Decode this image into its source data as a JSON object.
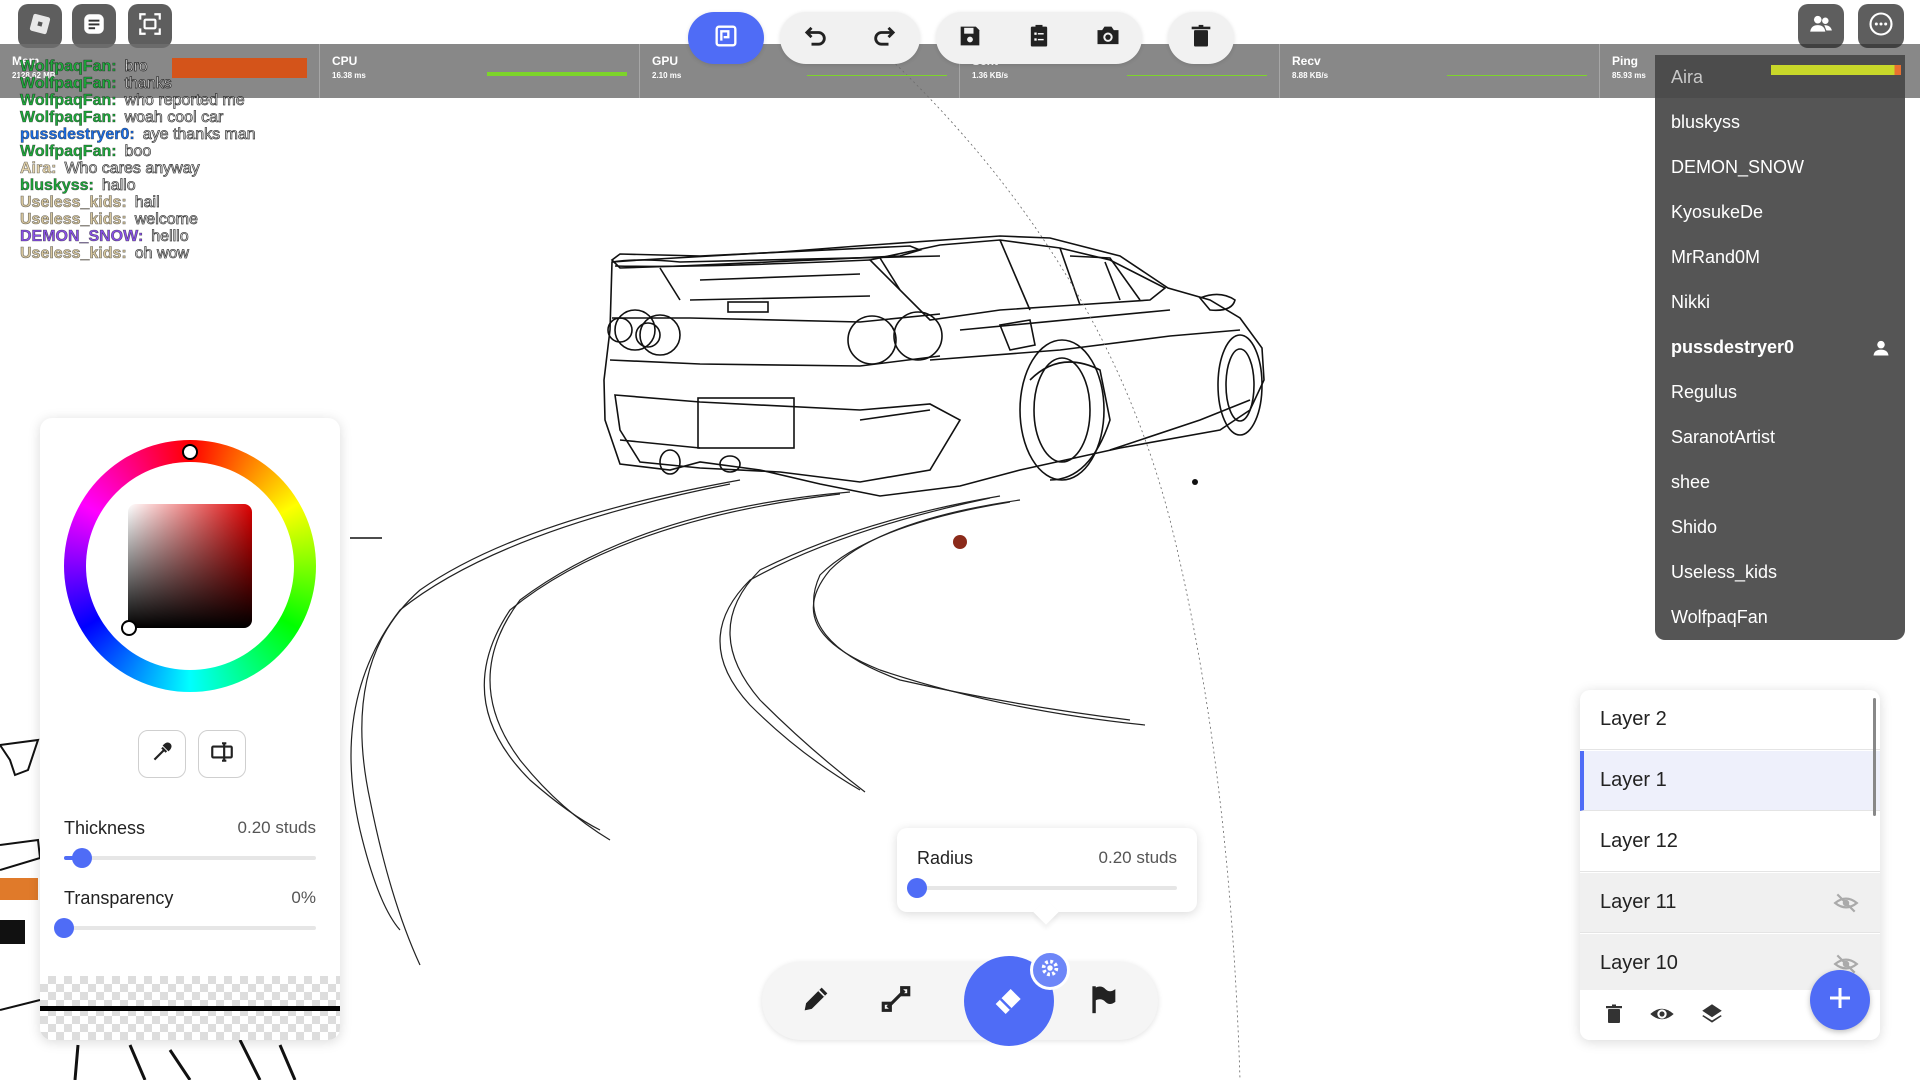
{
  "stats": [
    {
      "label": "Mem",
      "value": "2128.62 MB",
      "graph_color": "#d4541a"
    },
    {
      "label": "CPU",
      "value": "16.38 ms",
      "graph_color": "#7dd42a"
    },
    {
      "label": "GPU",
      "value": "2.10 ms",
      "graph_color": "#7dd42a"
    },
    {
      "label": "Sent",
      "value": "1.36 KB/s",
      "graph_color": "#7dd42a"
    },
    {
      "label": "Recv",
      "value": "8.88 KB/s",
      "graph_color": "#7dd42a"
    },
    {
      "label": "Ping",
      "value": "85.93 ms",
      "graph_color": "#c8d82a"
    }
  ],
  "chat": [
    {
      "name": "WolfpaqFan:",
      "msg": "bro",
      "color": "#1faa3c"
    },
    {
      "name": "WolfpaqFan:",
      "msg": "thanks",
      "color": "#1faa3c"
    },
    {
      "name": "WolfpaqFan:",
      "msg": "who reported me",
      "color": "#1faa3c"
    },
    {
      "name": "WolfpaqFan:",
      "msg": "woah cool car",
      "color": "#1faa3c"
    },
    {
      "name": "pussdestryer0:",
      "msg": "aye thanks man",
      "color": "#1c6fe8"
    },
    {
      "name": "WolfpaqFan:",
      "msg": "boo",
      "color": "#1faa3c"
    },
    {
      "name": "Aira:",
      "msg": "Who cares anyway",
      "color": "#e8d8b0"
    },
    {
      "name": "bluskyss:",
      "msg": "hallo",
      "color": "#1faa3c"
    },
    {
      "name": "Useless_kids:",
      "msg": "hail",
      "color": "#d8c8a0"
    },
    {
      "name": "Useless_kids:",
      "msg": "welcome",
      "color": "#d8c8a0"
    },
    {
      "name": "DEMON_SNOW:",
      "msg": "helllo",
      "color": "#8a52e8"
    },
    {
      "name": "Useless_kids:",
      "msg": "oh wow",
      "color": "#d8c8a0"
    }
  ],
  "players": [
    {
      "name": "Aira",
      "dim": true,
      "bold": false,
      "friend": false
    },
    {
      "name": "bluskyss",
      "dim": false,
      "bold": false,
      "friend": false
    },
    {
      "name": "DEMON_SNOW",
      "dim": false,
      "bold": false,
      "friend": false
    },
    {
      "name": "KyosukeDe",
      "dim": false,
      "bold": false,
      "friend": false
    },
    {
      "name": "MrRand0M",
      "dim": false,
      "bold": false,
      "friend": false
    },
    {
      "name": "Nikki",
      "dim": false,
      "bold": false,
      "friend": false
    },
    {
      "name": "pussdestryer0",
      "dim": false,
      "bold": true,
      "friend": true
    },
    {
      "name": "Regulus",
      "dim": false,
      "bold": false,
      "friend": false
    },
    {
      "name": "SaranotArtist",
      "dim": false,
      "bold": false,
      "friend": false
    },
    {
      "name": "shee",
      "dim": false,
      "bold": false,
      "friend": false
    },
    {
      "name": "Shido",
      "dim": false,
      "bold": false,
      "friend": false
    },
    {
      "name": "Useless_kids",
      "dim": false,
      "bold": false,
      "friend": false
    },
    {
      "name": "WolfpaqFan",
      "dim": false,
      "bold": false,
      "friend": false
    }
  ],
  "color_panel": {
    "thickness_label": "Thickness",
    "thickness_value": "0.20 studs",
    "thickness_level": 0.07,
    "transparency_label": "Transparency",
    "transparency_value": "0%",
    "transparency_level": 0.0,
    "accent": "#4f6cf6"
  },
  "radius_popup": {
    "label": "Radius",
    "value": "0.20 studs",
    "level": 0.0
  },
  "layers": [
    {
      "name": "Layer 2",
      "selected": false,
      "hidden": false
    },
    {
      "name": "Layer 1",
      "selected": true,
      "hidden": false
    },
    {
      "name": "Layer 12",
      "selected": false,
      "hidden": false
    },
    {
      "name": "Layer 11",
      "selected": false,
      "hidden": true
    },
    {
      "name": "Layer 10",
      "selected": false,
      "hidden": true
    }
  ],
  "icons": {
    "roblox": "roblox-logo-icon",
    "chat": "chat-icon",
    "fullscreen": "fullscreen-icon",
    "layers-app": "app-logo-icon",
    "undo": "undo-icon",
    "redo": "redo-icon",
    "save": "save-icon",
    "clipboard": "clipboard-icon",
    "camera": "camera-icon",
    "delete": "trash-icon",
    "pen": "pen-icon",
    "line": "line-icon",
    "eraser": "eraser-icon",
    "flag": "flag-icon",
    "settings": "gear-icon",
    "eyedropper": "eyedropper-icon",
    "text-field": "text-field-icon",
    "eye": "eye-icon",
    "eye-off": "eye-off-icon",
    "add": "plus-icon"
  }
}
